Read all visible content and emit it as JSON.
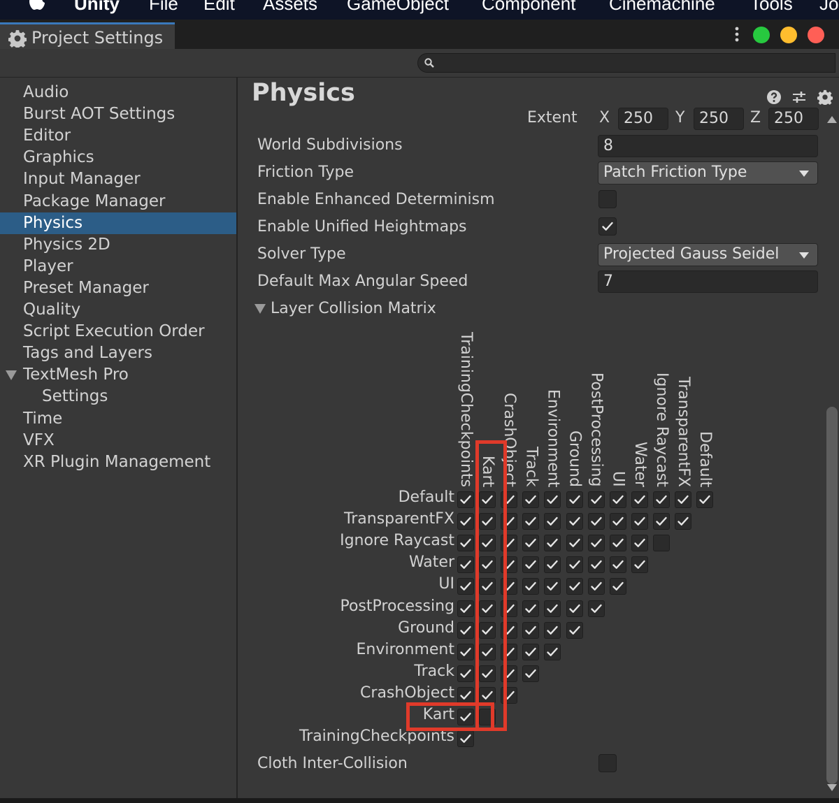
{
  "menubar": {
    "app": "Unity",
    "items": [
      "File",
      "Edit",
      "Assets",
      "GameObject",
      "Component",
      "Cinemachine",
      "Tools",
      "Jo"
    ]
  },
  "tab": {
    "title": "Project Settings"
  },
  "traffic_lights": {
    "green": "#27c93f",
    "yellow": "#ffbd2e",
    "red": "#ff5f56"
  },
  "search": {
    "value": "",
    "placeholder": ""
  },
  "sidebar": {
    "items": [
      {
        "label": "Audio"
      },
      {
        "label": "Burst AOT Settings"
      },
      {
        "label": "Editor"
      },
      {
        "label": "Graphics"
      },
      {
        "label": "Input Manager"
      },
      {
        "label": "Package Manager"
      },
      {
        "label": "Physics",
        "selected": true
      },
      {
        "label": "Physics 2D"
      },
      {
        "label": "Player"
      },
      {
        "label": "Preset Manager"
      },
      {
        "label": "Quality"
      },
      {
        "label": "Script Execution Order"
      },
      {
        "label": "Tags and Layers"
      },
      {
        "label": "TextMesh Pro",
        "expanded": true
      },
      {
        "label": "Settings",
        "child": true
      },
      {
        "label": "Time"
      },
      {
        "label": "VFX"
      },
      {
        "label": "XR Plugin Management"
      }
    ]
  },
  "physics": {
    "title": "Physics",
    "extent": {
      "label": "Extent",
      "x_label": "X",
      "x": "250",
      "y_label": "Y",
      "y": "250",
      "z_label": "Z",
      "z": "250"
    },
    "world_subdivisions": {
      "label": "World Subdivisions",
      "value": "8"
    },
    "friction_type": {
      "label": "Friction Type",
      "value": "Patch Friction Type"
    },
    "enhanced_determinism": {
      "label": "Enable Enhanced Determinism",
      "checked": false
    },
    "unified_heightmaps": {
      "label": "Enable Unified Heightmaps",
      "checked": true
    },
    "solver_type": {
      "label": "Solver Type",
      "value": "Projected Gauss Seidel"
    },
    "max_angular_speed": {
      "label": "Default Max Angular Speed",
      "value": "7"
    },
    "layer_collision_matrix": {
      "label": "Layer Collision Matrix",
      "layers": [
        "Default",
        "TransparentFX",
        "Ignore Raycast",
        "Water",
        "UI",
        "PostProcessing",
        "Ground",
        "Environment",
        "Track",
        "CrashObject",
        "Kart",
        "TrainingCheckpoints"
      ],
      "unchecked_pairs": [
        [
          "Ignore Raycast",
          "Ignore Raycast"
        ],
        [
          "Kart",
          "Kart"
        ]
      ]
    },
    "cloth_inter_collision": {
      "label": "Cloth Inter-Collision",
      "checked": false
    }
  },
  "highlight_color": "#e03a2a"
}
